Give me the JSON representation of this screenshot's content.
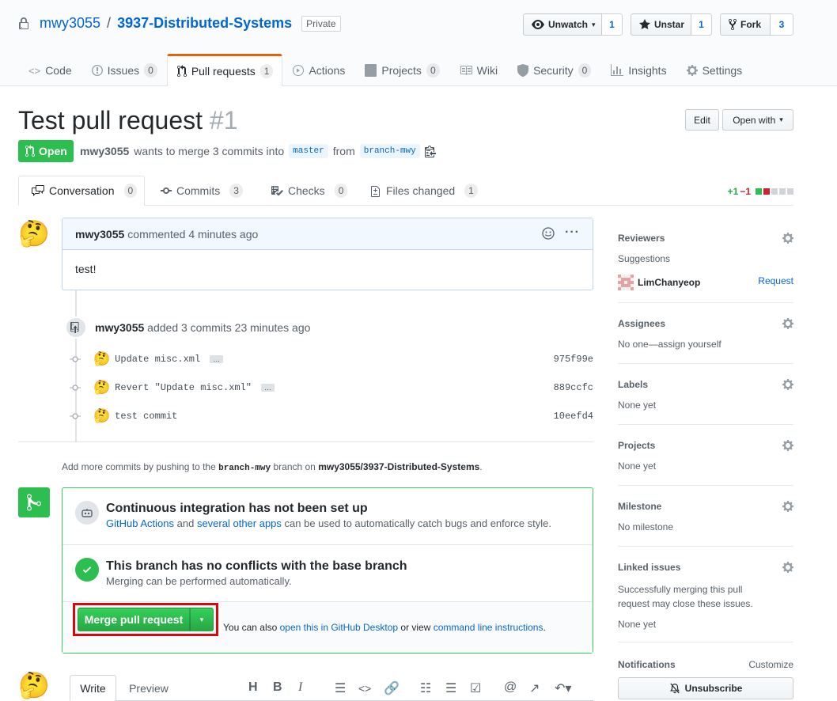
{
  "repo": {
    "owner": "mwy3055",
    "separator": "/",
    "name": "3937-Distributed-Systems",
    "visibility": "Private",
    "actions": [
      {
        "label": "Unwatch",
        "count": "1"
      },
      {
        "label": "Unstar",
        "count": "1"
      },
      {
        "label": "Fork",
        "count": "3"
      }
    ]
  },
  "nav": [
    {
      "label": "Code",
      "counter": null
    },
    {
      "label": "Issues",
      "counter": "0"
    },
    {
      "label": "Pull requests",
      "counter": "1"
    },
    {
      "label": "Actions",
      "counter": null
    },
    {
      "label": "Projects",
      "counter": "0"
    },
    {
      "label": "Wiki",
      "counter": null
    },
    {
      "label": "Security",
      "counter": "0"
    },
    {
      "label": "Insights",
      "counter": null
    },
    {
      "label": "Settings",
      "counter": null
    }
  ],
  "pr": {
    "title": "Test pull request",
    "number": "#1",
    "edit_label": "Edit",
    "open_with_label": "Open with",
    "state": "Open",
    "author": "mwy3055",
    "meta_text": "wants to merge 3 commits into",
    "base_branch": "master",
    "from_text": "from",
    "head_branch": "branch-mwy"
  },
  "tabs": [
    {
      "label": "Conversation",
      "counter": "0"
    },
    {
      "label": "Commits",
      "counter": "3"
    },
    {
      "label": "Checks",
      "counter": "0"
    },
    {
      "label": "Files changed",
      "counter": "1"
    }
  ],
  "diffstat": {
    "added": "+1",
    "removed": "−1"
  },
  "comment": {
    "author": "mwy3055",
    "action": "commented 4 minutes ago",
    "body": "test!"
  },
  "commits_event": {
    "author": "mwy3055",
    "action": "added 3 commits 23 minutes ago",
    "commits": [
      {
        "message": "Update misc.xml",
        "sha": "975f99e",
        "has_more": true
      },
      {
        "message": "Revert \"Update misc.xml\"",
        "sha": "889ccfc",
        "has_more": true
      },
      {
        "message": "test commit",
        "sha": "10eefd4",
        "has_more": false
      }
    ],
    "hidden_label": "…"
  },
  "push_note": {
    "prefix": "Add more commits by pushing to the",
    "branch": "branch-mwy",
    "middle": "branch on",
    "repo": "mwy3055/3937-Distributed-Systems",
    "suffix": "."
  },
  "mergebox": {
    "ci_title": "Continuous integration has not been set up",
    "ci_link1": "GitHub Actions",
    "ci_and": "and",
    "ci_link2": "several other apps",
    "ci_rest": "can be used to automatically catch bugs and enforce style.",
    "conflict_title": "This branch has no conflicts with the base branch",
    "conflict_sub": "Merging can be performed automatically.",
    "merge_label": "Merge pull request",
    "also_prefix": "You can also",
    "desktop_link": "open this in GitHub Desktop",
    "or_view": "or view",
    "cli_link": "command line instructions",
    "also_suffix": "."
  },
  "sidebar": {
    "reviewers": {
      "heading": "Reviewers",
      "suggestions": "Suggestions",
      "suggested_user": "LimChanyeop",
      "request": "Request"
    },
    "assignees": {
      "heading": "Assignees",
      "value": "No one—assign yourself"
    },
    "labels": {
      "heading": "Labels",
      "value": "None yet"
    },
    "projects": {
      "heading": "Projects",
      "value": "None yet"
    },
    "milestone": {
      "heading": "Milestone",
      "value": "No milestone"
    },
    "linked_issues": {
      "heading": "Linked issues",
      "description": "Successfully merging this pull request may close these issues.",
      "value": "None yet"
    },
    "notifications": {
      "heading": "Notifications",
      "customize": "Customize",
      "unsubscribe": "Unsubscribe"
    }
  },
  "form": {
    "write": "Write",
    "preview": "Preview"
  },
  "emoji": "🤔"
}
